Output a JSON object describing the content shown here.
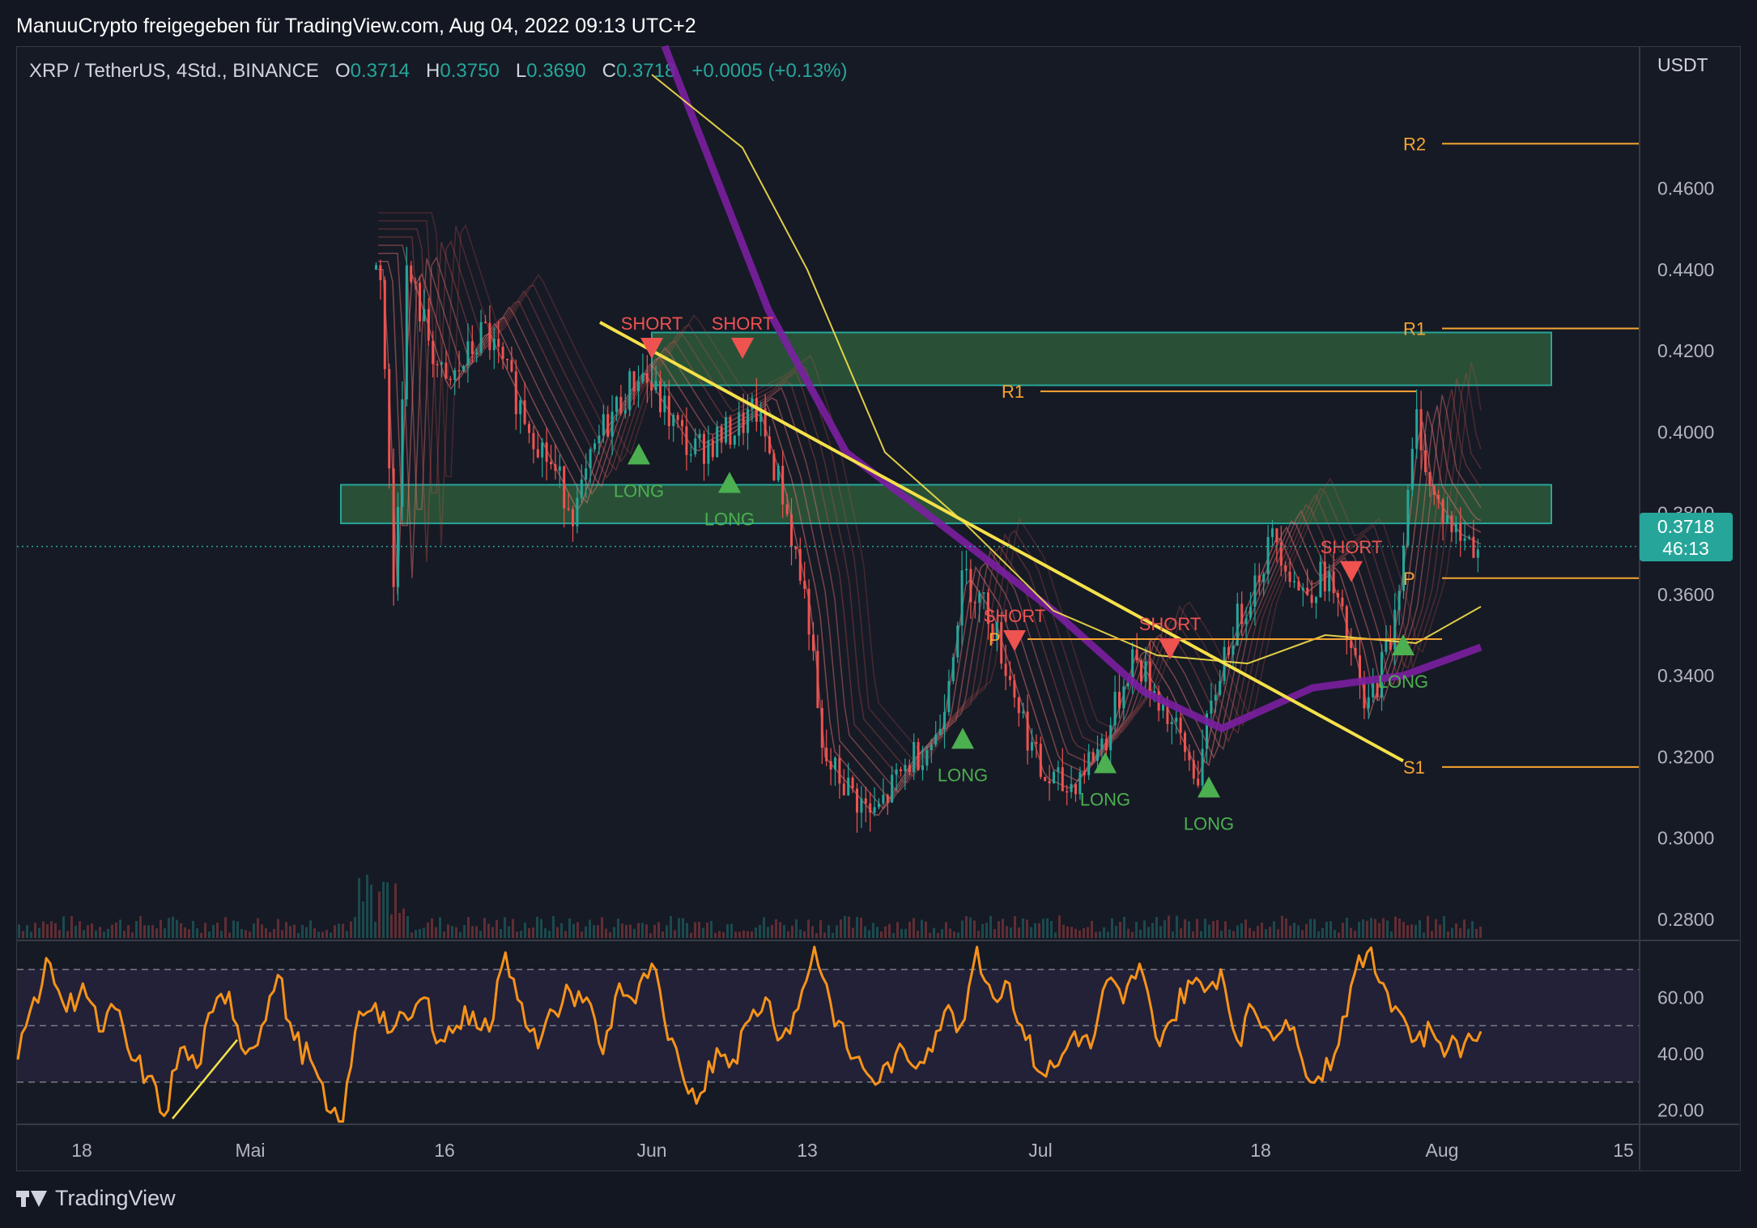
{
  "header": {
    "title": "ManuuCrypto freigegeben für TradingView.com, Aug 04, 2022 09:13 UTC+2"
  },
  "symbol_bar": {
    "symbol": "XRP / TetherUS, 4Std., BINANCE",
    "open_label": "O",
    "open": "0.3714",
    "high_label": "H",
    "high": "0.3750",
    "low_label": "L",
    "low": "0.3690",
    "close_label": "C",
    "close": "0.3718",
    "change": "+0.0005 (+0.13%)"
  },
  "price_axis": {
    "currency": "USDT",
    "last_price": "0.3718",
    "countdown": "46:13"
  },
  "footer": {
    "brand": "TradingView"
  },
  "colors": {
    "background": "#131722",
    "up": "#26a69a",
    "down": "#ef5350",
    "zone_fill": "#2d5a3a",
    "zone_border": "#26a69a",
    "trendline": "#f5e14a",
    "pivot": "#f7a531",
    "ma_purple": "#7b1fa2",
    "rsi": "#f7931a"
  },
  "chart_data": [
    {
      "type": "candlestick",
      "title": "XRP / TetherUS, 4Std., BINANCE",
      "ylim": [
        0.275,
        0.495
      ],
      "y_ticks": [
        "0.4600",
        "0.4400",
        "0.4200",
        "0.4000",
        "0.3800",
        "0.3600",
        "0.3400",
        "0.3200",
        "0.3000",
        "0.2800"
      ],
      "x_ticks": [
        "18",
        "Mai",
        "16",
        "Jun",
        "13",
        "Jul",
        "18",
        "Aug",
        "15"
      ],
      "x_tick_dates": [
        "2022-04-18",
        "2022-05-01",
        "2022-05-16",
        "2022-06-01",
        "2022-06-13",
        "2022-07-01",
        "2022-07-18",
        "2022-08-01",
        "2022-08-15"
      ],
      "price_path": [
        [
          "2022-05-11",
          0.44
        ],
        [
          "2022-05-12",
          0.36
        ],
        [
          "2022-05-13",
          0.44
        ],
        [
          "2022-05-16",
          0.41
        ],
        [
          "2022-05-19",
          0.425
        ],
        [
          "2022-05-22",
          0.405
        ],
        [
          "2022-05-26",
          0.38
        ],
        [
          "2022-05-28",
          0.4
        ],
        [
          "2022-05-31",
          0.415
        ],
        [
          "2022-06-02",
          0.405
        ],
        [
          "2022-06-04",
          0.395
        ],
        [
          "2022-06-07",
          0.4
        ],
        [
          "2022-06-09",
          0.405
        ],
        [
          "2022-06-11",
          0.385
        ],
        [
          "2022-06-13",
          0.355
        ],
        [
          "2022-06-14",
          0.32
        ],
        [
          "2022-06-18",
          0.305
        ],
        [
          "2022-06-21",
          0.32
        ],
        [
          "2022-06-23",
          0.325
        ],
        [
          "2022-06-25",
          0.365
        ],
        [
          "2022-06-27",
          0.355
        ],
        [
          "2022-06-29",
          0.335
        ],
        [
          "2022-07-01",
          0.315
        ],
        [
          "2022-07-03",
          0.312
        ],
        [
          "2022-07-06",
          0.325
        ],
        [
          "2022-07-08",
          0.345
        ],
        [
          "2022-07-10",
          0.335
        ],
        [
          "2022-07-13",
          0.315
        ],
        [
          "2022-07-15",
          0.345
        ],
        [
          "2022-07-17",
          0.36
        ],
        [
          "2022-07-19",
          0.375
        ],
        [
          "2022-07-21",
          0.36
        ],
        [
          "2022-07-23",
          0.365
        ],
        [
          "2022-07-25",
          0.345
        ],
        [
          "2022-07-26",
          0.33
        ],
        [
          "2022-07-28",
          0.35
        ],
        [
          "2022-07-29",
          0.375
        ],
        [
          "2022-07-30",
          0.405
        ],
        [
          "2022-07-31",
          0.385
        ],
        [
          "2022-08-02",
          0.375
        ],
        [
          "2022-08-04",
          0.3718
        ]
      ],
      "zones": [
        {
          "from": "2022-06-01",
          "to": "2022-08-15",
          "low": 0.4115,
          "high": 0.4245
        },
        {
          "from": "2022-05-08",
          "to": "2022-08-15",
          "low": 0.3775,
          "high": 0.387
        }
      ],
      "trendline": [
        [
          "2022-05-28",
          0.427
        ],
        [
          "2022-07-29",
          0.319
        ]
      ],
      "pivot_lines": [
        {
          "label": "R2",
          "y": 0.471,
          "from": "2022-08-01",
          "to": "2022-08-21"
        },
        {
          "label": "R1",
          "y": 0.4255,
          "from": "2022-08-01",
          "to": "2022-08-21"
        },
        {
          "label": "R1",
          "y": 0.41,
          "from": "2022-07-01",
          "to": "2022-07-30"
        },
        {
          "label": "P",
          "y": 0.364,
          "from": "2022-08-01",
          "to": "2022-08-21"
        },
        {
          "label": "P",
          "y": 0.349,
          "from": "2022-06-30",
          "to": "2022-08-01"
        },
        {
          "label": "S1",
          "y": 0.3175,
          "from": "2022-08-01",
          "to": "2022-08-21"
        }
      ],
      "signals": [
        {
          "label": "LONG",
          "x": "2022-05-31",
          "y": 0.392
        },
        {
          "label": "SHORT",
          "x": "2022-06-01",
          "y": 0.418
        },
        {
          "label": "SHORT",
          "x": "2022-06-08",
          "y": 0.418
        },
        {
          "label": "LONG",
          "x": "2022-06-07",
          "y": 0.385
        },
        {
          "label": "LONG",
          "x": "2022-06-25",
          "y": 0.322
        },
        {
          "label": "SHORT",
          "x": "2022-06-29",
          "y": 0.346
        },
        {
          "label": "LONG",
          "x": "2022-07-06",
          "y": 0.316
        },
        {
          "label": "SHORT",
          "x": "2022-07-11",
          "y": 0.344
        },
        {
          "label": "LONG",
          "x": "2022-07-14",
          "y": 0.31
        },
        {
          "label": "SHORT",
          "x": "2022-07-25",
          "y": 0.363
        },
        {
          "label": "LONG",
          "x": "2022-07-29",
          "y": 0.345
        }
      ],
      "moving_average_purple": [
        [
          "2022-06-02",
          0.495
        ],
        [
          "2022-06-10",
          0.43
        ],
        [
          "2022-06-16",
          0.395
        ],
        [
          "2022-06-23",
          0.378
        ],
        [
          "2022-07-02",
          0.356
        ],
        [
          "2022-07-09",
          0.336
        ],
        [
          "2022-07-15",
          0.327
        ],
        [
          "2022-07-22",
          0.337
        ],
        [
          "2022-07-29",
          0.34
        ],
        [
          "2022-08-04",
          0.347
        ]
      ],
      "moving_average_yellow": [
        [
          "2022-06-01",
          0.488
        ],
        [
          "2022-06-08",
          0.47
        ],
        [
          "2022-06-13",
          0.44
        ],
        [
          "2022-06-19",
          0.395
        ],
        [
          "2022-06-25",
          0.378
        ],
        [
          "2022-07-02",
          0.356
        ],
        [
          "2022-07-10",
          0.345
        ],
        [
          "2022-07-17",
          0.343
        ],
        [
          "2022-07-23",
          0.35
        ],
        [
          "2022-07-30",
          0.348
        ],
        [
          "2022-08-04",
          0.357
        ]
      ]
    },
    {
      "type": "line",
      "title": "",
      "ylim": [
        15,
        80
      ],
      "y_ticks": [
        "60.00",
        "40.00",
        "20.00"
      ],
      "band": [
        30,
        70
      ],
      "midline": 50,
      "series": [
        {
          "values": [
            38,
            60,
            72,
            55,
            65,
            48,
            56,
            38,
            32,
            18,
            42,
            35,
            55,
            62,
            40,
            50,
            68,
            45,
            38,
            20,
            16,
            55,
            58,
            48,
            52,
            60,
            45,
            50,
            55,
            48,
            76,
            58,
            42,
            55,
            62,
            60,
            40,
            65,
            58,
            72,
            45,
            30,
            26,
            42,
            38,
            52,
            60,
            46,
            56,
            78,
            58,
            42,
            35,
            30,
            40,
            36,
            42,
            55,
            50,
            78,
            60,
            65,
            45,
            33,
            36,
            48,
            42,
            66,
            58,
            72,
            46,
            52,
            66,
            62,
            70,
            45,
            56,
            48,
            52,
            38,
            32,
            40,
            64,
            76,
            65,
            55,
            45,
            48,
            42,
            44,
            48
          ]
        }
      ]
    }
  ]
}
